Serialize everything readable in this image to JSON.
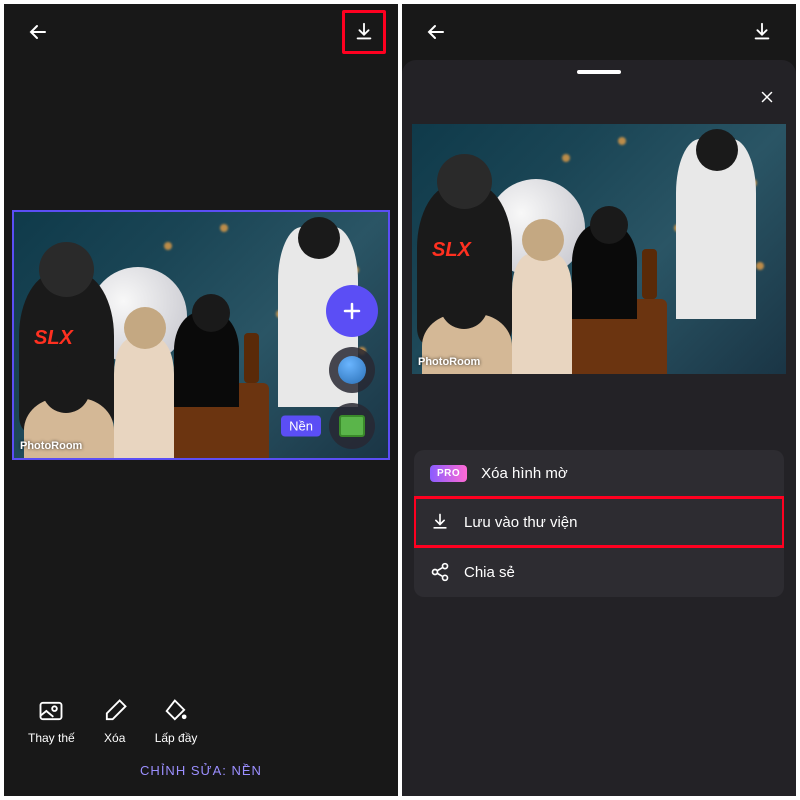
{
  "left": {
    "watermark": "PhotoRoom",
    "layer_label": "Nền",
    "tools": {
      "replace": "Thay thế",
      "delete": "Xóa",
      "fill": "Lấp đầy"
    },
    "editing_label": "CHỈNH SỬA: NỀN",
    "tshirt_text": "SLX"
  },
  "right": {
    "watermark": "PhotoRoom",
    "options": {
      "pro_badge": "PRO",
      "remove_watermark": "Xóa hình mờ",
      "save_to_library": "Lưu vào thư viện",
      "share": "Chia sẻ"
    }
  }
}
